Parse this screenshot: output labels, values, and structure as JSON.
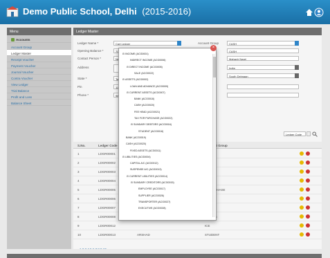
{
  "app": {
    "title": "Demo Public School, Delhi",
    "year": "(2015-2016)"
  },
  "sidebar": {
    "heading": "Menu",
    "items": [
      {
        "label": "Accounts"
      },
      {
        "label": "Account Group"
      },
      {
        "label": "Ledger Master"
      },
      {
        "label": "Receipt Voucher"
      },
      {
        "label": "Payment Voucher"
      },
      {
        "label": "Journal Voucher"
      },
      {
        "label": "Contra Voucher"
      },
      {
        "label": "View Ledger"
      },
      {
        "label": "Trial Balance"
      },
      {
        "label": "Profit and Loss"
      },
      {
        "label": "Balance Sheet"
      }
    ]
  },
  "main": {
    "heading": "Ledger Master",
    "form": {
      "ledger_name_label": "Ledger Name *",
      "ledger_name_value": "Cart Ledger",
      "opening_balance_label": "Opening Balance *",
      "opening_balance_value": "7000",
      "contact_person_label": "Contact Person *",
      "contact_person_value": "Neha",
      "address_label": "Address",
      "state_label": "State *",
      "state_value": "Tam",
      "pin_label": "Pin",
      "pin_value": "1100",
      "phone_label": "Phone *",
      "phone_value": "9890",
      "account_group_label": "Account Group",
      "account_group_value": "CASH",
      "right_field_2": "CASH",
      "right_field_3": "Mahavir Nagri",
      "right_select_1": "India",
      "right_select_2": "South Delmaan"
    },
    "search": {
      "select_value": "Ledger Code"
    },
    "table": {
      "headers": [
        "S.No.",
        "Ledger Code",
        "Ledger Name",
        "Account Group"
      ],
      "rows": [
        {
          "sno": "1",
          "code": "LDGR00001",
          "name": "",
          "group": ""
        },
        {
          "sno": "2",
          "code": "LDGR00002",
          "name": "",
          "group": ""
        },
        {
          "sno": "3",
          "code": "LDGR00003",
          "name": "",
          "group": ""
        },
        {
          "sno": "4",
          "code": "LDGR00004",
          "name": "",
          "group": "HASE"
        },
        {
          "sno": "5",
          "code": "LDGR00005",
          "name": "",
          "group": "D PURCHASE"
        },
        {
          "sno": "6",
          "code": "LDGR00006",
          "name": "",
          "group": "R SALE"
        },
        {
          "sno": "7",
          "code": "LDGR00007",
          "name": "",
          "group": "EAD"
        },
        {
          "sno": "8",
          "code": "LDGR00008",
          "name": "",
          "group": "ASSETS"
        },
        {
          "sno": "9",
          "code": "LDGR00012",
          "name": "",
          "group": "ICE"
        },
        {
          "sno": "10",
          "code": "LDGR00013",
          "name": "ARSHAD",
          "group": "STUDENT"
        }
      ]
    },
    "pagination": "1 2 3 4 5 6 7 8 9 10 ..."
  },
  "tree": {
    "items": [
      {
        "label": "INCOME (ACG0001)",
        "level": 0,
        "toggle": "⊟"
      },
      {
        "label": "INDIRECT INCOME (ACG0006)",
        "level": 1,
        "toggle": ""
      },
      {
        "label": "DIRECT INCOME (ACG0005)",
        "level": 1,
        "toggle": "⊟"
      },
      {
        "label": "SALE (ACG0022)",
        "level": 2,
        "toggle": ""
      },
      {
        "label": "ASSETS (ACG0002)",
        "level": 0,
        "toggle": "⊟"
      },
      {
        "label": "LOAN AND ADVANCE (ACG0009)",
        "level": 1,
        "toggle": ""
      },
      {
        "label": "CURRENT ASSETS (ACG0007)",
        "level": 1,
        "toggle": "⊟"
      },
      {
        "label": "BANK (ACG0018)",
        "level": 2,
        "toggle": ""
      },
      {
        "label": "CASH (ACG0020)",
        "level": 2,
        "toggle": ""
      },
      {
        "label": "FEE HEAD (ACG0021)",
        "level": 2,
        "toggle": ""
      },
      {
        "label": "TAX FOR PURCHASE (ACG0022)",
        "level": 2,
        "toggle": ""
      },
      {
        "label": "SUNDARY DEBTORS (ACG0016)",
        "level": 2,
        "toggle": "⊟"
      },
      {
        "label": "STUDENT (ACG0018)",
        "level": 3,
        "toggle": ""
      },
      {
        "label": "BANK (ACG0019)",
        "level": 0,
        "toggle": ""
      },
      {
        "label": "CASH (ACG0020)",
        "level": 0,
        "toggle": ""
      },
      {
        "label": "FIXED ASSETS (ACG0011)",
        "level": 1,
        "toggle": ""
      },
      {
        "label": "LIBILITIES (ACG0004)",
        "level": 0,
        "toggle": "⊟"
      },
      {
        "label": "CAPITAL A/C (ACG0012)",
        "level": 1,
        "toggle": ""
      },
      {
        "label": "SUSPENSE A/C (ACG0013)",
        "level": 1,
        "toggle": ""
      },
      {
        "label": "CURRENT LIBILITIES (ACG0014)",
        "level": 1,
        "toggle": "⊟"
      },
      {
        "label": "SUNDARY CREDITORS (ACG0015)",
        "level": 2,
        "toggle": "⊟"
      },
      {
        "label": "EMPLOYEE (ACG0017)",
        "level": 3,
        "toggle": ""
      },
      {
        "label": "SUPPLIER (ACG0026)",
        "level": 3,
        "toggle": ""
      },
      {
        "label": "TRANSPORTER (ACG0027)",
        "level": 3,
        "toggle": ""
      },
      {
        "label": "EXECUTIVE (ACG0028)",
        "level": 3,
        "toggle": ""
      }
    ]
  },
  "colors": {
    "topbar": "#1f7fbf",
    "sidebar": "#c8c8c8",
    "modal_close": "#d9534f",
    "edit_icon": "#e6b800",
    "delete_icon": "#cc3333"
  }
}
